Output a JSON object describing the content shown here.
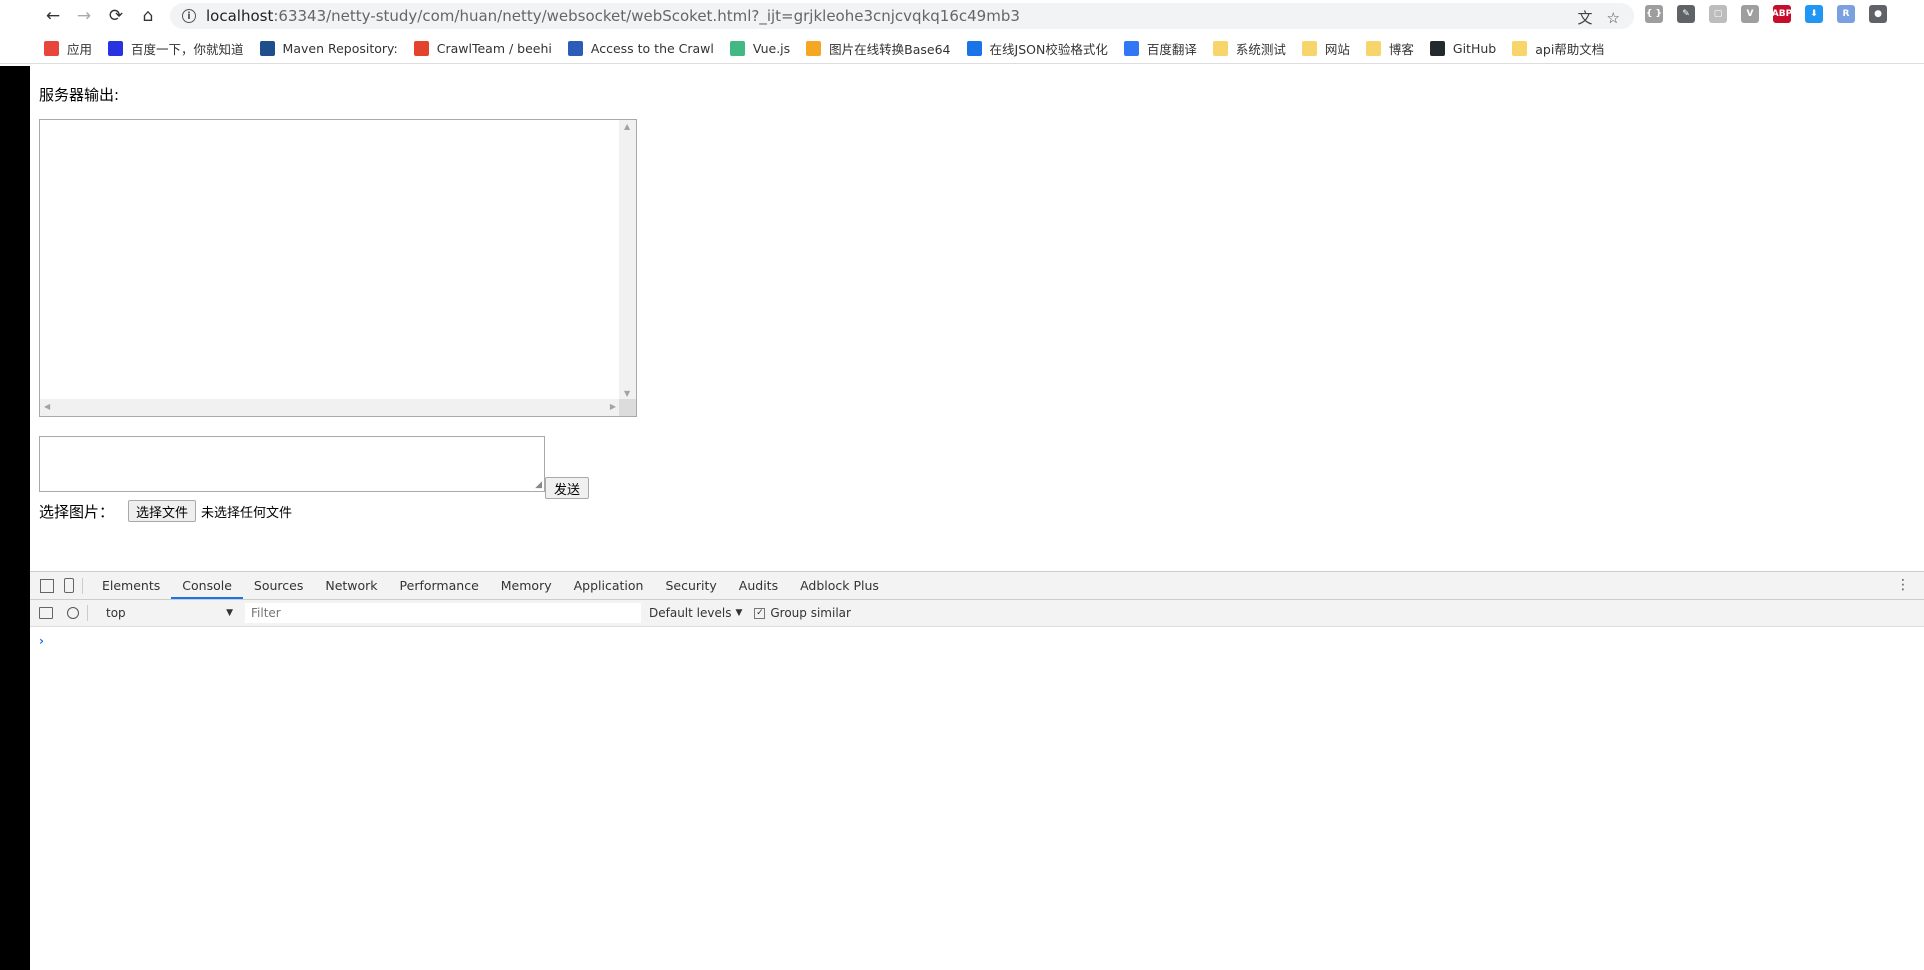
{
  "browser": {
    "url_host": "localhost",
    "url_rest": ":63343/netty-study/com/huan/netty/websocket/webScoket.html?_ijt=grjkleohe3cnjcvqkq16c49mb3",
    "nav": {
      "back": "←",
      "forward": "→",
      "reload": "⟳",
      "home": "⌂"
    },
    "extensions": [
      {
        "name": "ext-braces-icon",
        "label": "{ }",
        "color": "#9e9e9e"
      },
      {
        "name": "eyedropper-icon",
        "label": "✎",
        "color": "#5f6368"
      },
      {
        "name": "ext-grey-icon",
        "label": "▢",
        "color": "#bdbdbd"
      },
      {
        "name": "vue-devtools-icon",
        "label": "V",
        "color": "#9e9e9e"
      },
      {
        "name": "adblock-plus-icon",
        "label": "ABP",
        "color": "#c70d2c"
      },
      {
        "name": "download-ext-icon",
        "label": "⬇",
        "color": "#2196f3"
      },
      {
        "name": "ext-blue-icon",
        "label": "R",
        "color": "#7aa0e0"
      },
      {
        "name": "profile-icon",
        "label": "●",
        "color": "#5f6368"
      }
    ]
  },
  "bookmarks": [
    {
      "name": "bookmark-apps",
      "label": "应用",
      "icon": "apps-grid-icon",
      "color": "#e8453c"
    },
    {
      "name": "bookmark-baidu",
      "label": "百度一下，你就知道",
      "icon": "baidu-paw-icon",
      "color": "#2932e1"
    },
    {
      "name": "bookmark-maven",
      "label": "Maven Repository:",
      "icon": "mvn-icon",
      "color": "#1f4e8c"
    },
    {
      "name": "bookmark-crawlteam",
      "label": "CrawlTeam / beehi",
      "icon": "gitlab-icon",
      "color": "#e2432a"
    },
    {
      "name": "bookmark-access",
      "label": "Access to the Crawl",
      "icon": "jira-icon",
      "color": "#2a5cb8"
    },
    {
      "name": "bookmark-vuejs",
      "label": "Vue.js",
      "icon": "vue-icon",
      "color": "#42b883"
    },
    {
      "name": "bookmark-base64",
      "label": "图片在线转换Base64",
      "icon": "image-icon",
      "color": "#f5a623"
    },
    {
      "name": "bookmark-json",
      "label": "在线JSON校验格式化",
      "icon": "json-icon",
      "color": "#1a73e8"
    },
    {
      "name": "bookmark-translate",
      "label": "百度翻译",
      "icon": "translate-icon",
      "color": "#3076f6"
    },
    {
      "name": "bookmark-systest",
      "label": "系统测试",
      "icon": "folder-icon",
      "color": "#f7d56b"
    },
    {
      "name": "bookmark-website",
      "label": "网站",
      "icon": "folder-icon",
      "color": "#f7d56b"
    },
    {
      "name": "bookmark-blog",
      "label": "博客",
      "icon": "folder-icon",
      "color": "#f7d56b"
    },
    {
      "name": "bookmark-github",
      "label": "GitHub",
      "icon": "github-icon",
      "color": "#24292e"
    },
    {
      "name": "bookmark-api-docs",
      "label": "api帮助文档",
      "icon": "folder-icon",
      "color": "#f7d56b"
    }
  ],
  "page": {
    "output_label": "服务器输出:",
    "output_value": "",
    "message_value": "",
    "send_label": "发送",
    "choose_image_label": "选择图片：",
    "choose_file_button": "选择文件",
    "file_status": "未选择任何文件"
  },
  "devtools": {
    "tabs": [
      "Elements",
      "Console",
      "Sources",
      "Network",
      "Performance",
      "Memory",
      "Application",
      "Security",
      "Audits",
      "Adblock Plus"
    ],
    "active_tab": "Console",
    "context": "top",
    "filter_placeholder": "Filter",
    "levels_label": "Default levels",
    "group_similar_label": "Group similar",
    "group_similar_checked": true,
    "prompt": "›"
  }
}
